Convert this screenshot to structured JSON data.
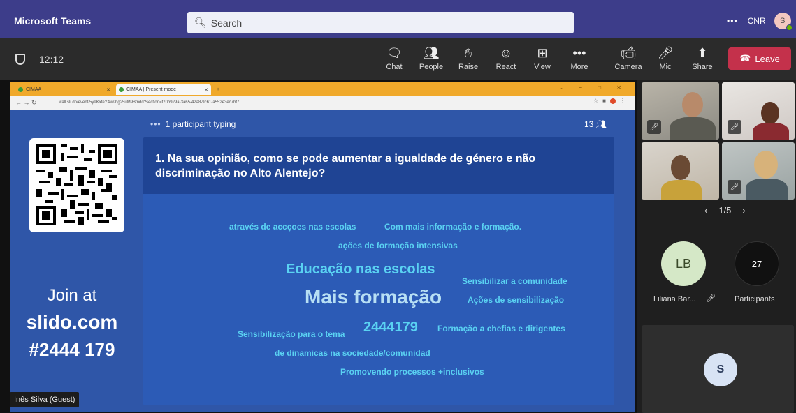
{
  "app": {
    "title": "Microsoft Teams",
    "account": "CNR",
    "avatar_initial": "S"
  },
  "search": {
    "placeholder": "Search"
  },
  "meeting": {
    "timer": "12:12",
    "controls": [
      {
        "label": "Chat",
        "icon": "chat-icon"
      },
      {
        "label": "People",
        "icon": "people-icon"
      },
      {
        "label": "Raise",
        "icon": "raise-hand-icon"
      },
      {
        "label": "React",
        "icon": "react-icon"
      },
      {
        "label": "View",
        "icon": "view-icon"
      },
      {
        "label": "More",
        "icon": "more-icon"
      },
      {
        "label": "Camera",
        "icon": "camera-off-icon"
      },
      {
        "label": "Mic",
        "icon": "mic-off-icon"
      },
      {
        "label": "Share",
        "icon": "share-icon"
      }
    ],
    "leave_label": "Leave"
  },
  "browser": {
    "tabs": [
      {
        "label": "CIMAA"
      },
      {
        "label": "CIMAA | Present mode"
      }
    ],
    "url": "wall.sli.do/event/5y9KxfeY4wr/bg25uM9Bmdd?section=f70b929a-3a65-42a8-9c61-a552e3ec7bf7"
  },
  "slido": {
    "typing_text": "1 participant typing",
    "participant_count": "13",
    "join_line1": "Join at",
    "join_line2": "slido.com",
    "join_line3": "#2444 179",
    "question": "1. Na sua opinião, como se pode aumentar a igualdade de género e não discriminação no Alto Alentejo?",
    "words": [
      "através de accçoes nas escolas",
      "Com mais informação e formação.",
      "ações de formação intensivas",
      "Educação nas escolas",
      "Sensibilizar a comunidade",
      "Mais formação",
      "Ações de sensibilização",
      "Sensibilização para o tema",
      "2444179",
      "Formação a chefias e dirigentes",
      "de dinamicas na sociedade/comunidad",
      "Promovendo processos +inclusivos"
    ]
  },
  "presenter_label": "Inês Silva (Guest)",
  "sidebar": {
    "pager": "1/5",
    "participant_initials": "LB",
    "participant_name": "Liliana Bar...",
    "participants_count": "27",
    "participants_label": "Participants",
    "self_initial": "S"
  }
}
